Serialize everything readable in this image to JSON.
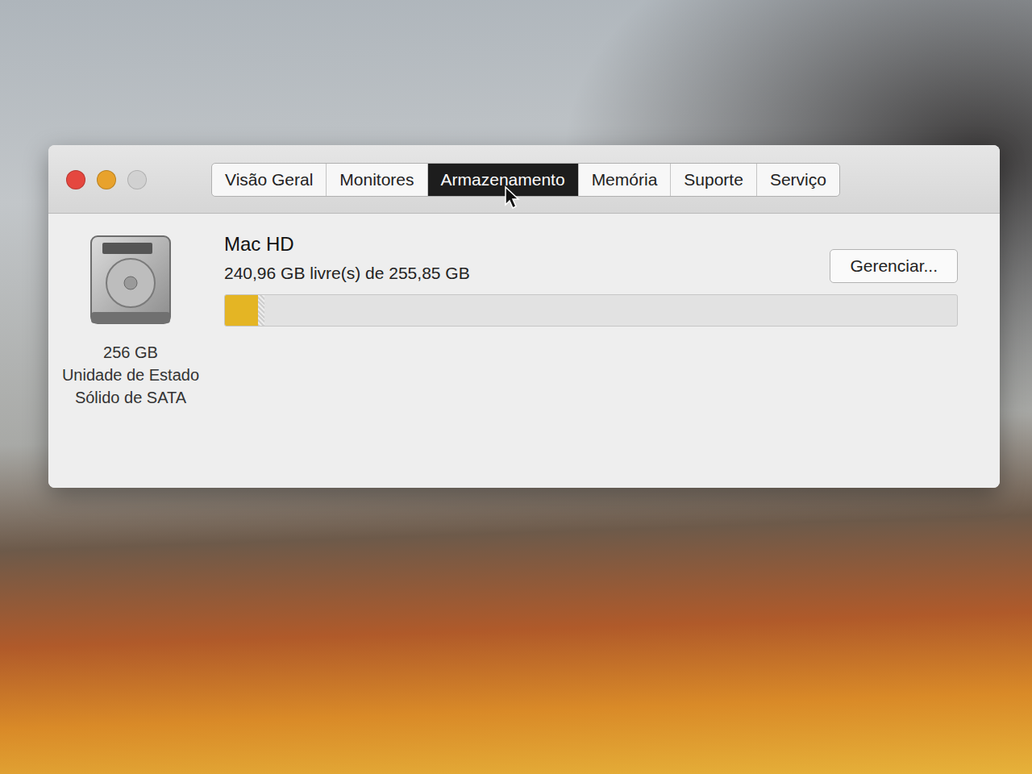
{
  "window": {
    "controls": [
      {
        "kind": "close",
        "disabled": false,
        "color": "#e5473f"
      },
      {
        "kind": "minimize",
        "disabled": false,
        "color": "#e8a22c"
      },
      {
        "kind": "zoom",
        "disabled": true,
        "color": "#cfcfcf"
      }
    ]
  },
  "tabs": [
    {
      "label": "Visão Geral",
      "selected": false
    },
    {
      "label": "Monitores",
      "selected": false
    },
    {
      "label": "Armazenamento",
      "selected": true
    },
    {
      "label": "Memória",
      "selected": false
    },
    {
      "label": "Suporte",
      "selected": false
    },
    {
      "label": "Serviço",
      "selected": false
    }
  ],
  "disk": {
    "capacity": "256 GB",
    "type": "Unidade de Estado Sólido de SATA",
    "name": "Mac HD",
    "summary": "240,96 GB livre(s) de 255,85 GB",
    "level": 0.045,
    "color": "#e4b524"
  },
  "buttons": [
    "Gerenciar..."
  ]
}
